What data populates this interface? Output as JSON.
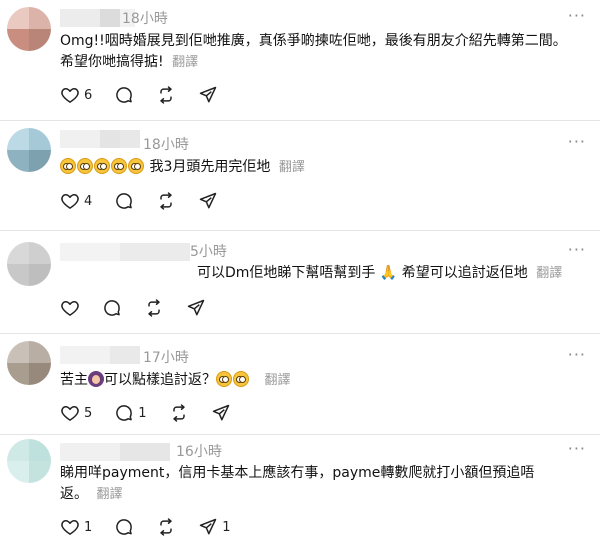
{
  "replies": [
    {
      "time": "18小時",
      "text": "Omg!!咽時婚展見到佢哋推廣，真係爭啲揀咗佢哋，最後有朋友介紹先轉第二間。希望你哋搞得掂!",
      "translate": "翻譯",
      "counts": {
        "like": "6",
        "comment": "",
        "repost": "",
        "share": ""
      }
    },
    {
      "time": "18小時",
      "text": "我3月頭先用完佢地",
      "emojis": [
        "flushed-face",
        "flushed-face",
        "flushed-face",
        "flushed-face",
        "flushed-face"
      ],
      "translate": "翻譯",
      "counts": {
        "like": "4",
        "comment": "",
        "repost": "",
        "share": ""
      }
    },
    {
      "time": "5小時",
      "text": "可以Dm佢地睇下幫唔幫到手",
      "text_after": "希望可以追討返佢地",
      "emojis": [
        "folded-hands"
      ],
      "translate": "翻譯",
      "counts": {
        "like": "",
        "comment": "",
        "repost": "",
        "share": ""
      }
    },
    {
      "time": "17小時",
      "text_before": "苦主",
      "text": "可以點樣追討返？",
      "emojis": [
        "person-tipping-hand",
        "pleading-face",
        "pleading-face"
      ],
      "translate": "翻譯",
      "counts": {
        "like": "5",
        "comment": "1",
        "repost": "",
        "share": ""
      }
    },
    {
      "time": "16小時",
      "text": "睇用咩payment，信用卡基本上應該冇事，payme轉數爬就打小額但預追唔返。",
      "translate": "翻譯",
      "counts": {
        "like": "1",
        "comment": "",
        "repost": "",
        "share": "1"
      }
    }
  ],
  "more_glyph": "···",
  "icons": [
    "heart-icon",
    "comment-icon",
    "repost-icon",
    "share-icon",
    "more-icon"
  ]
}
